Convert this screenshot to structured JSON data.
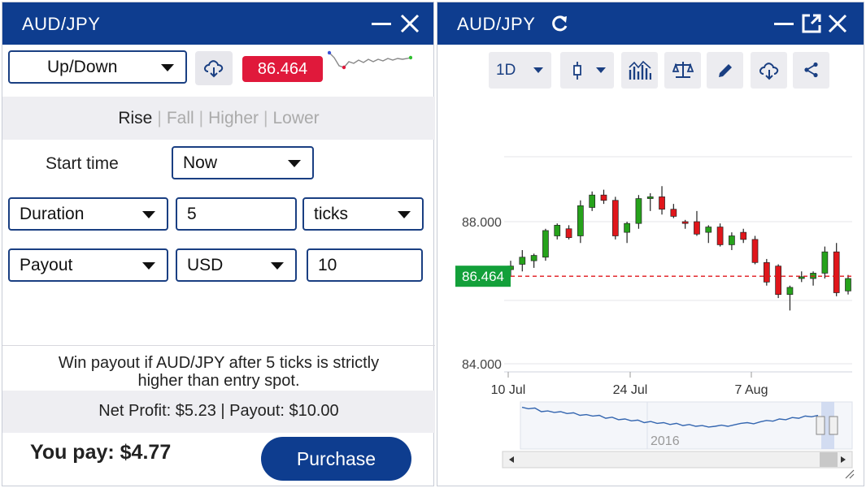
{
  "trade_panel": {
    "title": "AUD/JPY",
    "contract_type": "Up/Down",
    "current_price": "86.464",
    "tabs": [
      "Rise",
      "Fall",
      "Higher",
      "Lower"
    ],
    "active_tab": "Rise",
    "start_time_label": "Start time",
    "start_time_value": "Now",
    "duration_type": "Duration",
    "duration_value": "5",
    "duration_unit": "ticks",
    "basis": "Payout",
    "currency": "USD",
    "amount": "10",
    "description_line1": "Win payout if AUD/JPY after 5 ticks is strictly",
    "description_line2": "higher than entry spot.",
    "net_profit": "Net Profit: $5.23 | Payout: $10.00",
    "you_pay": "You pay: $4.77",
    "purchase_label": "Purchase",
    "colors": {
      "header": "#0e3d8f",
      "price_badge": "#e0193b",
      "border": "#1a3f82"
    }
  },
  "chart_panel": {
    "title": "AUD/JPY",
    "timeframe": "1D",
    "toolbar_icons": [
      "candlestick-icon",
      "indicators-icon",
      "compare-icon",
      "draw-icon",
      "download-icon",
      "share-icon"
    ],
    "price_tag": "86.464",
    "navigator_year": "2016"
  },
  "chart_data": {
    "type": "candlestick",
    "ylim": [
      84.0,
      89.0
    ],
    "yticks": [
      {
        "value": 88.0,
        "label": "88.000"
      },
      {
        "value": 84.0,
        "label": "84.000"
      }
    ],
    "xticks": [
      "10 Jul",
      "24 Jul",
      "7 Aug"
    ],
    "current_price": 86.464,
    "candles": [
      {
        "o": 86.65,
        "h": 86.9,
        "l": 86.45,
        "c": 86.75
      },
      {
        "o": 86.8,
        "h": 87.2,
        "l": 86.6,
        "c": 87.0
      },
      {
        "o": 86.9,
        "h": 87.1,
        "l": 86.7,
        "c": 87.05
      },
      {
        "o": 87.0,
        "h": 87.8,
        "l": 86.9,
        "c": 87.75
      },
      {
        "o": 87.6,
        "h": 87.95,
        "l": 87.5,
        "c": 87.9
      },
      {
        "o": 87.8,
        "h": 87.9,
        "l": 87.5,
        "c": 87.55
      },
      {
        "o": 87.6,
        "h": 88.6,
        "l": 87.4,
        "c": 88.45
      },
      {
        "o": 88.4,
        "h": 88.85,
        "l": 88.3,
        "c": 88.75
      },
      {
        "o": 88.75,
        "h": 88.9,
        "l": 88.5,
        "c": 88.6
      },
      {
        "o": 88.6,
        "h": 88.7,
        "l": 87.5,
        "c": 87.6
      },
      {
        "o": 87.7,
        "h": 88.0,
        "l": 87.4,
        "c": 87.95
      },
      {
        "o": 87.95,
        "h": 88.75,
        "l": 87.8,
        "c": 88.65
      },
      {
        "o": 88.65,
        "h": 88.8,
        "l": 88.3,
        "c": 88.7
      },
      {
        "o": 88.7,
        "h": 89.0,
        "l": 88.2,
        "c": 88.35
      },
      {
        "o": 88.35,
        "h": 88.5,
        "l": 88.1,
        "c": 88.15
      },
      {
        "o": 88.0,
        "h": 88.05,
        "l": 87.8,
        "c": 87.95
      },
      {
        "o": 88.0,
        "h": 88.3,
        "l": 87.6,
        "c": 87.65
      },
      {
        "o": 87.7,
        "h": 87.9,
        "l": 87.4,
        "c": 87.85
      },
      {
        "o": 87.85,
        "h": 87.95,
        "l": 87.3,
        "c": 87.35
      },
      {
        "o": 87.35,
        "h": 87.7,
        "l": 87.2,
        "c": 87.6
      },
      {
        "o": 87.7,
        "h": 87.8,
        "l": 87.4,
        "c": 87.5
      },
      {
        "o": 87.5,
        "h": 87.6,
        "l": 86.8,
        "c": 86.85
      },
      {
        "o": 86.85,
        "h": 86.95,
        "l": 86.2,
        "c": 86.3
      },
      {
        "o": 86.75,
        "h": 86.8,
        "l": 85.85,
        "c": 85.95
      },
      {
        "o": 85.95,
        "h": 86.2,
        "l": 85.5,
        "c": 86.15
      },
      {
        "o": 86.4,
        "h": 86.6,
        "l": 86.3,
        "c": 86.45
      },
      {
        "o": 86.4,
        "h": 86.6,
        "l": 86.2,
        "c": 86.55
      },
      {
        "o": 86.55,
        "h": 87.3,
        "l": 86.4,
        "c": 87.15
      },
      {
        "o": 87.15,
        "h": 87.4,
        "l": 85.9,
        "c": 86.0
      },
      {
        "o": 86.05,
        "h": 86.5,
        "l": 85.95,
        "c": 86.4
      }
    ],
    "navigator_series": [
      0.72,
      0.68,
      0.7,
      0.6,
      0.62,
      0.58,
      0.6,
      0.55,
      0.57,
      0.5,
      0.52,
      0.48,
      0.5,
      0.42,
      0.45,
      0.38,
      0.4,
      0.35,
      0.37,
      0.3,
      0.33,
      0.28,
      0.3,
      0.25,
      0.28,
      0.22,
      0.25,
      0.2,
      0.22,
      0.18,
      0.2,
      0.23,
      0.2,
      0.24,
      0.28,
      0.3,
      0.27,
      0.32,
      0.36,
      0.34,
      0.4,
      0.38,
      0.44,
      0.42,
      0.48,
      0.46,
      0.5
    ],
    "colors": {
      "up": "#26a21b",
      "down": "#e0161b",
      "price_line": "#e0161b",
      "price_tag": "#13a03a",
      "navigator_line": "#3466b0"
    }
  }
}
